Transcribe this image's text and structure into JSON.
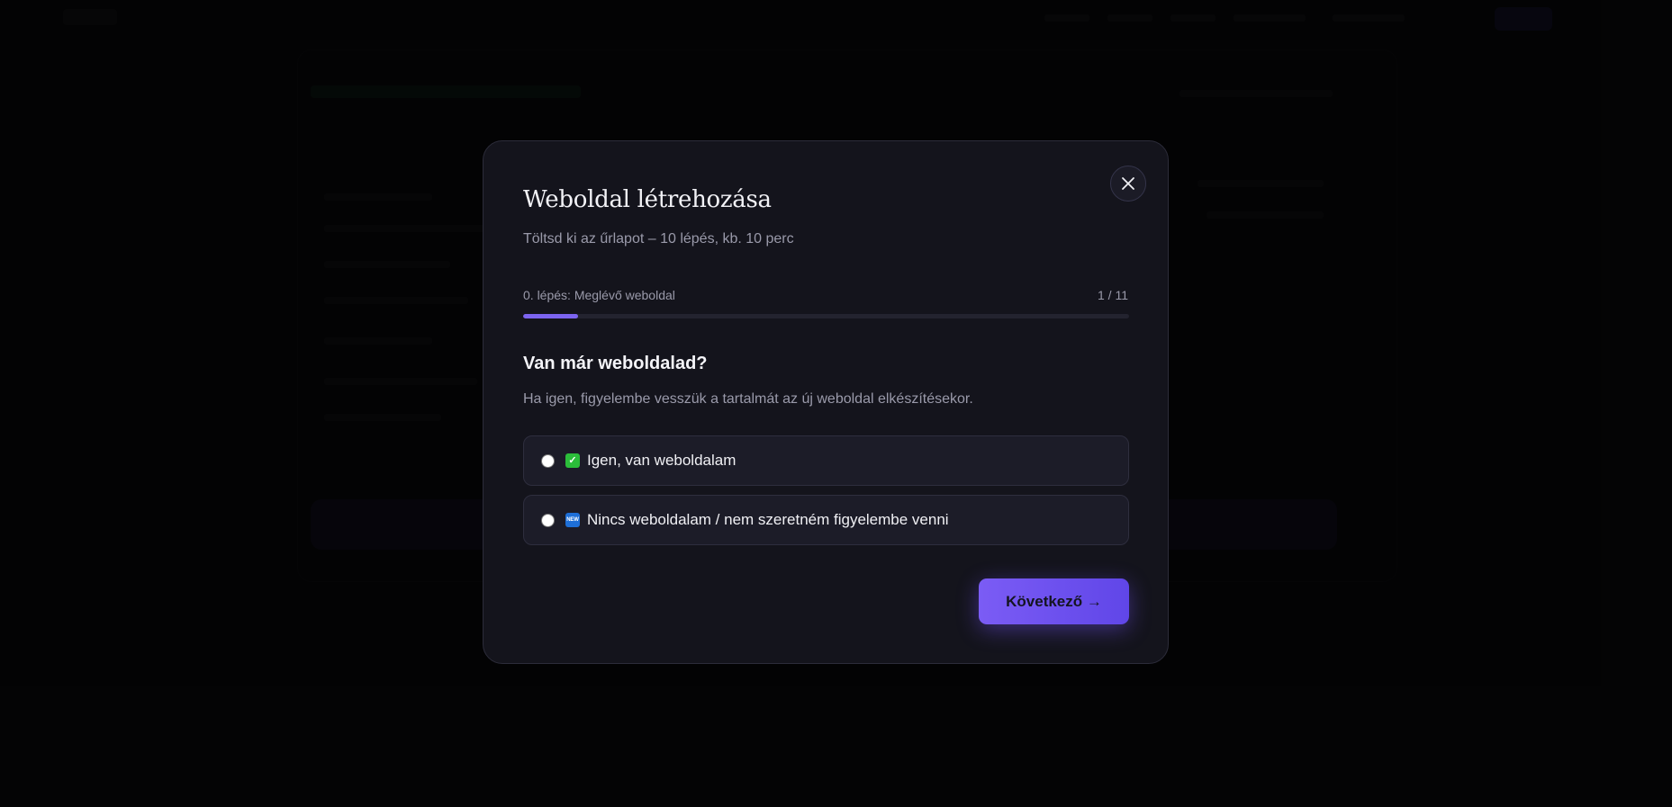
{
  "modal": {
    "title": "Weboldal létrehozása",
    "subtitle": "Töltsd ki az űrlapot – 10 lépés, kb. 10 perc",
    "close_icon": "close-icon"
  },
  "progress": {
    "step_label": "0. lépés: Meglévő weboldal",
    "step_count": "1 / 11",
    "fraction": 0.0909,
    "color": "#7c64f0"
  },
  "question": {
    "title": "Van már weboldalad?",
    "help": "Ha igen, figyelembe vesszük a tartalmát az új weboldal elkészítésekor."
  },
  "options": [
    {
      "icon": "check-mark-emoji",
      "icon_text": "✓",
      "label": "Igen, van weboldalam",
      "selected": false
    },
    {
      "icon": "new-badge-emoji",
      "icon_text": "NEW",
      "label": "Nincs weboldalam / nem szeretném figyelembe venni",
      "selected": false
    }
  ],
  "actions": {
    "next_label": "Következő →",
    "accent": "#6f52f0"
  }
}
